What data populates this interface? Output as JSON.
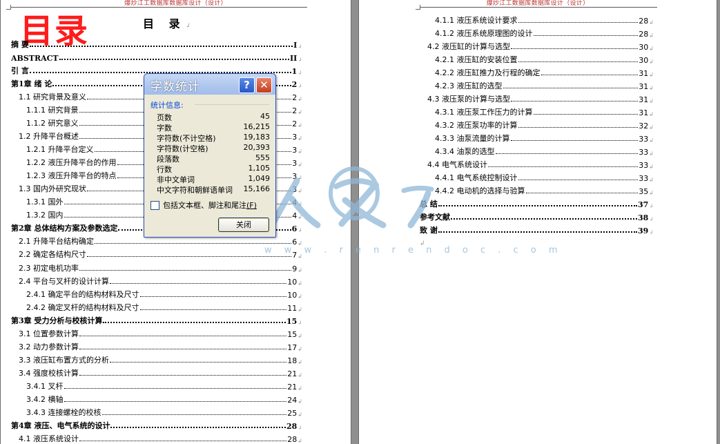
{
  "document": {
    "header_text": "爆炒江工数据库数据库设计（设计）",
    "big_title": "目录",
    "toc_heading": "目 录",
    "paragraph_mark": "↲",
    "watermark_url": "w w w . r e n r e n d o c . c o m",
    "watermark_logo_text": "人人文库"
  },
  "toc_left": [
    {
      "label": "摘  要",
      "page": "I",
      "bold": true
    },
    {
      "label": "ABSTRACT",
      "page": "II",
      "bold": true
    },
    {
      "label": "引  言",
      "page": "1",
      "bold": true
    },
    {
      "label": "第1章  绪  论",
      "page": "2",
      "bold": true
    },
    {
      "label": "1.1 研究背景及意义",
      "page": "2",
      "bold": false
    },
    {
      "label": "1.1.1 研究背景",
      "page": "2",
      "bold": false
    },
    {
      "label": "1.1.2 研究意义",
      "page": "2",
      "bold": false
    },
    {
      "label": "1.2 升降平台概述",
      "page": "3",
      "bold": false
    },
    {
      "label": "1.2.1 升降平台定义",
      "page": "3",
      "bold": false
    },
    {
      "label": "1.2.2 液压升降平台的作用",
      "page": "3",
      "bold": false
    },
    {
      "label": "1.2.3 液压升降平台的特点",
      "page": "3",
      "bold": false
    },
    {
      "label": "1.3 国内外研究现状",
      "page": "3",
      "bold": false
    },
    {
      "label": "1.3.1 国外",
      "page": "4",
      "bold": false
    },
    {
      "label": "1.3.2 国内",
      "page": "4",
      "bold": false
    },
    {
      "label": "第2章  总体结构方案及参数选定",
      "page": "6",
      "bold": true
    },
    {
      "label": "2.1 升降平台结构确定",
      "page": "6",
      "bold": false
    },
    {
      "label": "2.2 确定各结构尺寸",
      "page": "7",
      "bold": false
    },
    {
      "label": "2.3 初定电机功率",
      "page": "9",
      "bold": false
    },
    {
      "label": "2.4 平台与叉杆的设计计算",
      "page": "10",
      "bold": false
    },
    {
      "label": "2.4.1 确定平台的结构材料及尺寸",
      "page": "10",
      "bold": false
    },
    {
      "label": "2.4.2 确定叉杆的结构材料及尺寸",
      "page": "11",
      "bold": false
    },
    {
      "label": "第3章  受力分析与校核计算",
      "page": "15",
      "bold": true
    },
    {
      "label": "3.1 位置参数计算",
      "page": "15",
      "bold": false
    },
    {
      "label": "3.2 动力参数计算",
      "page": "17",
      "bold": false
    },
    {
      "label": "3.3 液压缸布置方式的分析",
      "page": "18",
      "bold": false
    },
    {
      "label": "3.4 强度校核计算",
      "page": "21",
      "bold": false
    },
    {
      "label": "3.4.1 叉杆",
      "page": "21",
      "bold": false
    },
    {
      "label": "3.4.2 横轴",
      "page": "24",
      "bold": false
    },
    {
      "label": "3.4.3 连接螺栓的校核",
      "page": "25",
      "bold": false
    },
    {
      "label": "第4章  液压、电气系统的设计",
      "page": "28",
      "bold": true
    },
    {
      "label": "4.1 液压系统设计",
      "page": "28",
      "bold": false
    }
  ],
  "toc_right": [
    {
      "label": "4.1.1 液压系统设计要求",
      "page": "28",
      "bold": false
    },
    {
      "label": "4.1.2 液压系统原理图的设计",
      "page": "28",
      "bold": false
    },
    {
      "label": "4.2 液压缸的计算与选型",
      "page": "30",
      "bold": false
    },
    {
      "label": "4.2.1  液压缸的安装位置",
      "page": "30",
      "bold": false
    },
    {
      "label": "4.2.2 液压缸推力及行程的确定",
      "page": "31",
      "bold": false
    },
    {
      "label": "4.2.3 液压缸的选型",
      "page": "31",
      "bold": false
    },
    {
      "label": "4.3 液压泵的计算与选型",
      "page": "31",
      "bold": false
    },
    {
      "label": "4.3.1  液压泵工作压力的计算",
      "page": "31",
      "bold": false
    },
    {
      "label": "4.3.2    液压泵功率的计算",
      "page": "32",
      "bold": false
    },
    {
      "label": "4.3.3    油泵流量的计算",
      "page": "33",
      "bold": false
    },
    {
      "label": "4.3.4    油泵的选型",
      "page": "33",
      "bold": false
    },
    {
      "label": "4.4 电气系统设计",
      "page": "33",
      "bold": false
    },
    {
      "label": "4.4.1  电气系统控制设计",
      "page": "33",
      "bold": false
    },
    {
      "label": "4.4.2 电动机的选择与验算",
      "page": "35",
      "bold": false
    },
    {
      "label": "总  结",
      "page": "37",
      "bold": true
    },
    {
      "label": "参考文献",
      "page": "38",
      "bold": true
    },
    {
      "label": "致  谢",
      "page": "39",
      "bold": true
    }
  ],
  "dialog": {
    "title": "字数统计",
    "help_label": "?",
    "close_x_label": "✕",
    "group_label": "统计信息:",
    "stats": [
      {
        "label": "页数",
        "value": "45"
      },
      {
        "label": "字数",
        "value": "16,215"
      },
      {
        "label": "字符数(不计空格)",
        "value": "19,183"
      },
      {
        "label": "字符数(计空格)",
        "value": "20,393"
      },
      {
        "label": "段落数",
        "value": "555"
      },
      {
        "label": "行数",
        "value": "1,105"
      },
      {
        "label": "非中文单词",
        "value": "1,049"
      },
      {
        "label": "中文字符和朝鲜语单词",
        "value": "15,166"
      }
    ],
    "checkbox_label": "包括文本框、脚注和尾注",
    "checkbox_hotkey": "(F)",
    "checkbox_checked": false,
    "close_button": "关闭"
  },
  "colors": {
    "big_title": "#ff1b1b",
    "dialog_title_bar": "#a2bdea",
    "group_label": "#0046d5",
    "watermark": "#8fb8d8"
  }
}
